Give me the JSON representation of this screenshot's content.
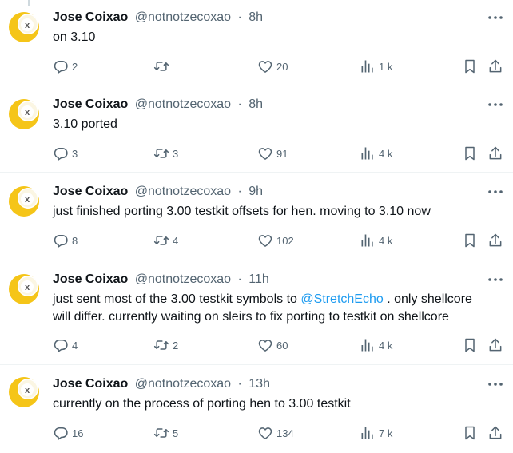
{
  "tweets": [
    {
      "name": "Jose Coixao",
      "handle": "@notnotzecoxao",
      "time": "8h",
      "text_parts": [
        "on 3.10"
      ],
      "replies": "2",
      "retweets": "",
      "likes": "20",
      "views": "1 k"
    },
    {
      "name": "Jose Coixao",
      "handle": "@notnotzecoxao",
      "time": "8h",
      "text_parts": [
        "3.10 ported"
      ],
      "replies": "3",
      "retweets": "3",
      "likes": "91",
      "views": "4 k"
    },
    {
      "name": "Jose Coixao",
      "handle": "@notnotzecoxao",
      "time": "9h",
      "text_parts": [
        "just finished porting 3.00 testkit offsets for hen. moving to 3.10 now"
      ],
      "replies": "8",
      "retweets": "4",
      "likes": "102",
      "views": "4 k"
    },
    {
      "name": "Jose Coixao",
      "handle": "@notnotzecoxao",
      "time": "11h",
      "text_parts": [
        "just sent most of the 3.00 testkit symbols to ",
        "@StretchEcho",
        " . only shellcore",
        "will differ. currently waiting on sleirs to fix porting to testkit on shellcore"
      ],
      "replies": "4",
      "retweets": "2",
      "likes": "60",
      "views": "4 k"
    },
    {
      "name": "Jose Coixao",
      "handle": "@notnotzecoxao",
      "time": "13h",
      "text_parts": [
        "currently on the process of porting hen to 3.00 testkit"
      ],
      "replies": "16",
      "retweets": "5",
      "likes": "134",
      "views": "7 k"
    }
  ],
  "separator": "·",
  "colors": {
    "text": "#0f1419",
    "muted": "#536471",
    "link": "#1d9bf0",
    "avatar": "#f5c518"
  }
}
